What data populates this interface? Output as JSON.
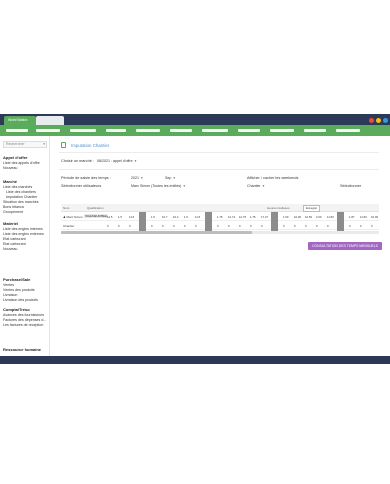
{
  "window": {
    "tab_title": "WorkStation",
    "controls": [
      {
        "name": "minimize",
        "color": "#e74c3c"
      },
      {
        "name": "maximize",
        "color": "#f1c40f"
      },
      {
        "name": "close",
        "color": "#3498db"
      }
    ]
  },
  "colors": {
    "accent": "#5bab5c",
    "header": "#2c3a58",
    "link": "#4a8fd4",
    "button": "#a266c4",
    "weekend": "#8c8c8c"
  },
  "sidebar": {
    "search_placeholder": "Rechercher",
    "sections": [
      {
        "title": "Appel d'offre",
        "items": [
          "Liste des appels d'offre",
          "Nouveau"
        ]
      },
      {
        "title": "Marché",
        "items": [
          "Liste des marchés",
          "Liste des chantiers",
          "Imputation Chantier",
          "Situation des marchés",
          "Bons bitanca",
          "Groupement"
        ]
      },
      {
        "title": "Matériel",
        "items": [
          "Liste des engins internes",
          "Liste des engins externes",
          "Etat carburant",
          "Etat carburant",
          "Nouveau"
        ]
      },
      {
        "title": "Purchase/Sale",
        "items": [
          "Ventes",
          "Ventes des produits",
          "Livraison",
          "Livraison des produits"
        ]
      },
      {
        "title": "Compta/Tréso",
        "items": [
          "Avances des fournisseurs",
          "Factures des dépenses d...",
          "Les factures de reception"
        ]
      },
      {
        "title": "Ressource humaine",
        "items": []
      }
    ]
  },
  "main": {
    "page_title": "Imputation Chantier",
    "market_label": "Choisir un marché :",
    "market_value": "08/2021 : appel d'offre",
    "period_label": "Période de saisie des temps :",
    "period_year": "2021",
    "period_month": "Sep",
    "weekend_label": "Afficher / cacher les weekends",
    "user_label": "Sélectionner utilisateurs",
    "user_value": "Marc Simon (Toutes les entités)",
    "site_value": "Chantier",
    "select_label": "Sélectionner",
    "grid": {
      "headers": [
        "Nom",
        "Qualification",
        "Heures réalisées"
      ],
      "button": "Enregist",
      "rows": [
        {
          "name": "Marc Simon",
          "qualification": "INGENIEUR/BEE",
          "values": [
            "12.5",
            "1.5",
            "11.5",
            "",
            "1.5",
            "10.7",
            "10.4",
            "1.5",
            "11.5",
            "",
            "1.75",
            "12.74",
            "12.75",
            "1.75",
            "17.37",
            "",
            "1.50",
            "10.00",
            "10.50",
            "2.00",
            "11.50",
            "",
            "1.87",
            "11.50",
            "10.00"
          ]
        },
        {
          "name": "Chantier",
          "qualification": "",
          "values": [
            "0",
            "0",
            "0",
            "",
            "0",
            "0",
            "0",
            "0",
            "0",
            "",
            "0",
            "0",
            "0",
            "0",
            "0",
            "",
            "0",
            "0",
            "0",
            "0",
            "0",
            "",
            "0",
            "0",
            "0"
          ]
        }
      ],
      "scroll_fraction": 0.6
    },
    "consult_button": "CONSULTATION DES TEMPS MENSUELS"
  }
}
